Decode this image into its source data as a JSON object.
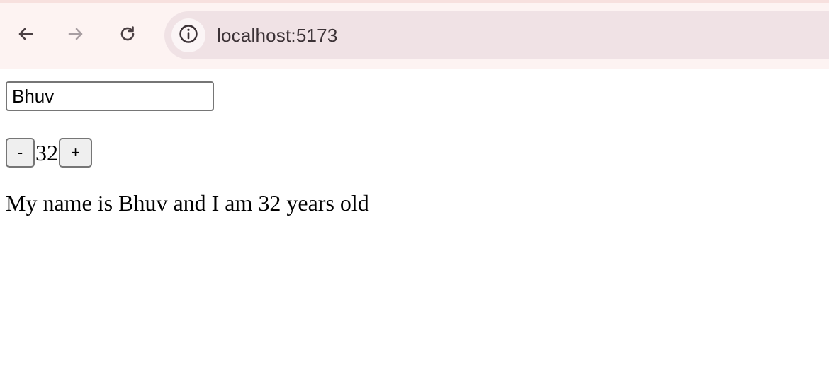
{
  "browser": {
    "url": "localhost:5173",
    "icons": {
      "back": "arrow-left-icon",
      "forward": "arrow-right-icon",
      "reload": "reload-icon",
      "site_info": "info-icon"
    }
  },
  "form": {
    "name_value": "Bhuv",
    "age_value": "32",
    "minus_label": "-",
    "plus_label": "+"
  },
  "output": {
    "sentence": "My name is Bhuv and I am 32 years old"
  },
  "colors": {
    "chrome_background": "#fdf3f2",
    "omnibox_background": "#f0e2e5",
    "button_background": "#efefef",
    "border": "#767676"
  }
}
